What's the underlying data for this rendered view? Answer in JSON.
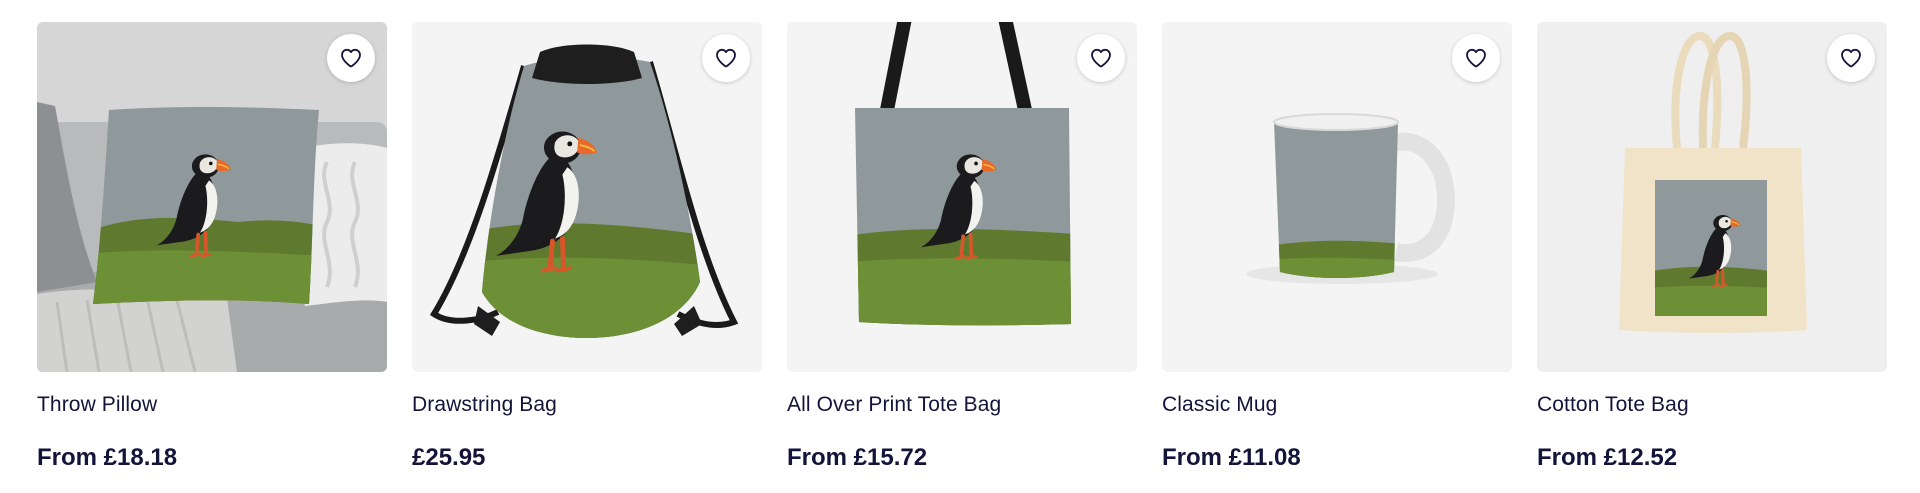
{
  "theme": {
    "text_color": "#14143b",
    "card_bg": "#f5f5f5"
  },
  "products": [
    {
      "title": "Throw Pillow",
      "price": "From £18.18",
      "icon": "heart-outline-icon"
    },
    {
      "title": "Drawstring Bag",
      "price": "£25.95",
      "icon": "heart-outline-icon"
    },
    {
      "title": "All Over Print Tote Bag",
      "price": "From £15.72",
      "icon": "heart-outline-icon"
    },
    {
      "title": "Classic Mug",
      "price": "From £11.08",
      "icon": "heart-outline-icon"
    },
    {
      "title": "Cotton Tote Bag",
      "price": "From £12.52",
      "icon": "heart-outline-icon"
    }
  ]
}
